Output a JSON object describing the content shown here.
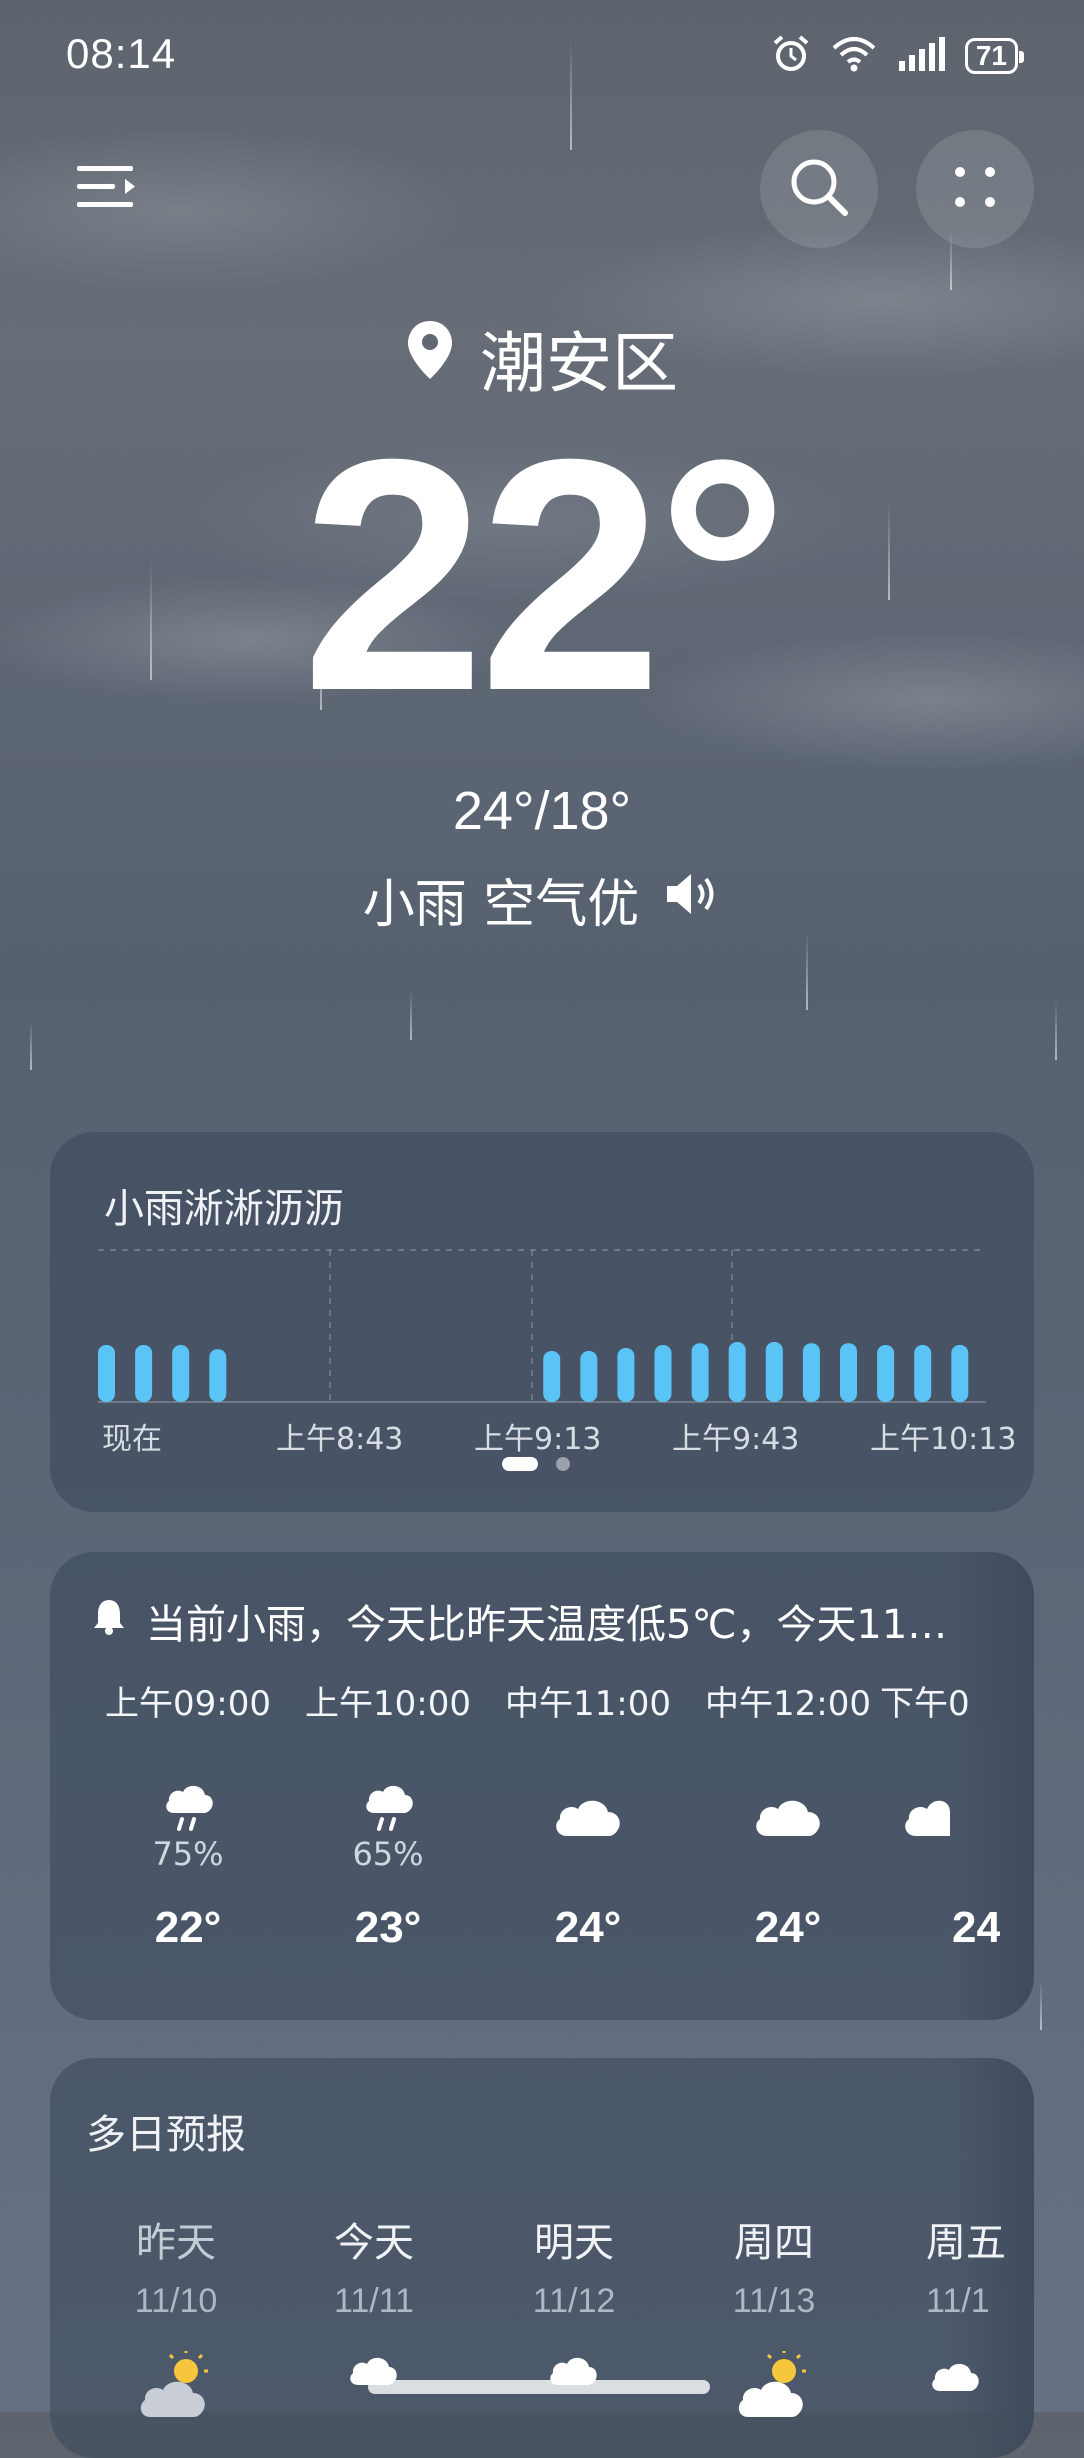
{
  "status_bar": {
    "time": "08:14",
    "battery": "71",
    "icons": [
      "alarm-icon",
      "wifi-icon",
      "signal-icon",
      "battery-icon"
    ]
  },
  "header": {
    "menu_icon": "menu-icon",
    "search_icon": "search-icon",
    "more_icon": "grid-dots-icon"
  },
  "current": {
    "location": "潮安区",
    "temperature": "22°",
    "range": "24°/18°",
    "condition": "小雨 空气优",
    "speaker_icon": "speaker-icon"
  },
  "precip_card": {
    "title": "小雨淅淅沥沥",
    "x_labels": [
      "现在",
      "上午8:43",
      "上午9:13",
      "上午9:43",
      "上午10:13"
    ],
    "page_indicator": {
      "active": 0,
      "count": 2
    }
  },
  "chart_data": {
    "type": "bar",
    "title": "小雨淅淅沥沥",
    "x_tick_labels": [
      "现在",
      "上午8:43",
      "上午9:13",
      "上午9:43",
      "上午10:13"
    ],
    "values": [
      0.95,
      0.95,
      0.95,
      0.88,
      0,
      0,
      0,
      0,
      0,
      0,
      0,
      0,
      0.85,
      0.85,
      0.9,
      0.95,
      0.98,
      1.0,
      1.0,
      0.98,
      0.98,
      0.95,
      0.95,
      0.95
    ],
    "bar_color": "#5bc4f7",
    "grid": true
  },
  "hourly_card": {
    "alert_icon": "bell-icon",
    "alert_text": "当前小雨，今天比昨天温度低5℃，今天11…",
    "hours": [
      {
        "time": "上午09:00",
        "icon": "rain-cloud-icon",
        "pop": "75%",
        "temp": "22°"
      },
      {
        "time": "上午10:00",
        "icon": "rain-cloud-icon",
        "pop": "65%",
        "temp": "23°"
      },
      {
        "time": "中午11:00",
        "icon": "cloud-icon",
        "pop": "",
        "temp": "24°"
      },
      {
        "time": "中午12:00",
        "icon": "cloud-icon",
        "pop": "",
        "temp": "24°"
      },
      {
        "time": "下午0",
        "icon": "cloud-icon",
        "pop": "",
        "temp": "24"
      }
    ]
  },
  "daily_card": {
    "title": "多日预报",
    "days": [
      {
        "name": "昨天",
        "date": "11/10",
        "icon": "sun-cloud-icon"
      },
      {
        "name": "今天",
        "date": "11/11",
        "icon": "rain-cloud-icon"
      },
      {
        "name": "明天",
        "date": "11/12",
        "icon": "rain-cloud-icon"
      },
      {
        "name": "周四",
        "date": "11/13",
        "icon": "sun-cloud-icon"
      },
      {
        "name": "周五",
        "date": "11/1",
        "icon": "cloud-icon"
      }
    ]
  },
  "colors": {
    "bar": "#5bc4f7",
    "card_bg": "#3e4a5c",
    "text_secondary": "#aeb7c3"
  }
}
